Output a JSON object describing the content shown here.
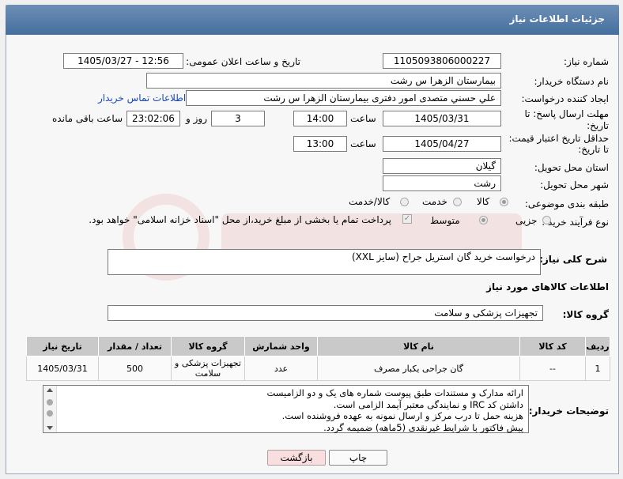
{
  "window": {
    "title": "جزئیات اطلاعات نیاز"
  },
  "form": {
    "need_number": {
      "label": "شماره نیاز:",
      "value": "1105093806000227"
    },
    "announce_datetime": {
      "label": "تاریخ و ساعت اعلان عمومی:",
      "value": "1405/03/27 - 12:56"
    },
    "buyer_org": {
      "label": "نام دستگاه خریدار:",
      "value": "بیمارستان الزهرا  س  رشت"
    },
    "requester": {
      "label": "ایجاد کننده درخواست:",
      "value": "علي حسني متصدی امور دفتری بیمارستان الزهرا  س  رشت",
      "contact_link": "اطلاعات تماس خریدار"
    },
    "reply_deadline": {
      "label_line1": "مهلت ارسال پاسخ: تا",
      "label_line2": "تاریخ:",
      "date": "1405/03/31",
      "time_label": "ساعت",
      "time": "14:00",
      "days": "3",
      "days_label": "روز و",
      "remaining": "23:02:06",
      "remaining_label": "ساعت باقی مانده"
    },
    "price_validity": {
      "label_line1": "حداقل تاریخ اعتبار قیمت:",
      "label_line2": "تا تاریخ:",
      "date": "1405/04/27",
      "time_label": "ساعت",
      "time": "13:00"
    },
    "province": {
      "label": "استان محل تحویل:",
      "value": "گیلان"
    },
    "city": {
      "label": "شهر محل تحویل:",
      "value": "رشت"
    },
    "category": {
      "label": "طبقه بندی موضوعی:",
      "options": [
        "کالا",
        "خدمت",
        "کالا/خدمت"
      ],
      "selected": "کالا"
    },
    "purchase_type": {
      "label": "نوع فرآیند خرید :",
      "options": [
        "جزیی",
        "متوسط"
      ],
      "selected": "متوسط",
      "payment_note": "پرداخت تمام یا بخشی از مبلغ خرید،از محل \"اسناد خزانه اسلامی\" خواهد بود."
    }
  },
  "description": {
    "label": "شرح کلی نیاز:",
    "value": "درخواست خرید گان استریل جراح (سایز XXL)"
  },
  "goods_section": {
    "title": "اطلاعات کالاهای مورد نیاز",
    "group_label": "گروه کالا:",
    "group_value": "تجهیزات پزشکی و سلامت",
    "table": {
      "headers": [
        "ردیف",
        "کد کالا",
        "نام کالا",
        "واحد شمارش",
        "گروه کالا",
        "تعداد / مقدار",
        "تاریخ نیاز"
      ],
      "rows": [
        [
          "1",
          "--",
          "گان جراحی یکبار مصرف",
          "عدد",
          "تجهیزات پزشکی و سلامت",
          "500",
          "1405/03/31"
        ]
      ]
    }
  },
  "buyer_notes": {
    "label": "توضیحات خریدار:",
    "lines": [
      "ارائه مدارک و مستندات طبق پیوست شماره های یک و دو الزامیست",
      "داشتن کد IRC و نمایندگی معتبر آیمد الزامی است.",
      "هزینه حمل تا درب مرکز و ارسال نمونه به عهده فروشنده است.",
      "پیش فاکتور با شرایط غیرنقدی (5ماهه) ضمیمه گردد."
    ]
  },
  "buttons": {
    "print": "چاپ",
    "back": "بازگشت"
  },
  "colors": {
    "titlebar": "#456f9e",
    "link": "#1a47b7",
    "back_button": "#f8dede"
  }
}
